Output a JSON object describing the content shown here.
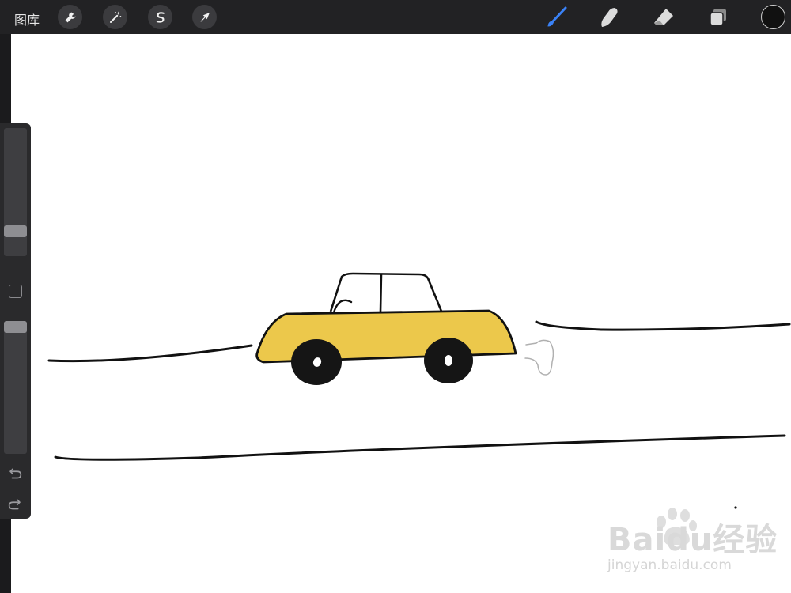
{
  "toolbar": {
    "gallery_label": "图库",
    "left_tools": [
      {
        "name": "actions",
        "icon": "wrench-icon"
      },
      {
        "name": "adjustments",
        "icon": "magic-wand-icon"
      },
      {
        "name": "selection",
        "icon": "selection-s-icon"
      },
      {
        "name": "transform",
        "icon": "arrow-cursor-icon"
      }
    ],
    "right_tools": [
      {
        "name": "brush",
        "icon": "brush-icon",
        "active": true
      },
      {
        "name": "smudge",
        "icon": "smudge-finger-icon"
      },
      {
        "name": "eraser",
        "icon": "eraser-icon"
      },
      {
        "name": "layers",
        "icon": "layers-icon"
      }
    ],
    "accent_color": "#3a82f7",
    "current_color": "#111111"
  },
  "sidebar": {
    "brush_size_level": 0.16,
    "opacity_level": 1.0,
    "undo_icon": "undo-icon",
    "redo_icon": "redo-icon"
  },
  "canvas": {
    "car_body_color": "#ecc84b",
    "stroke_color": "#111111"
  },
  "watermark": {
    "main": "Baidu经验",
    "sub": "jingyan.baidu.com"
  }
}
